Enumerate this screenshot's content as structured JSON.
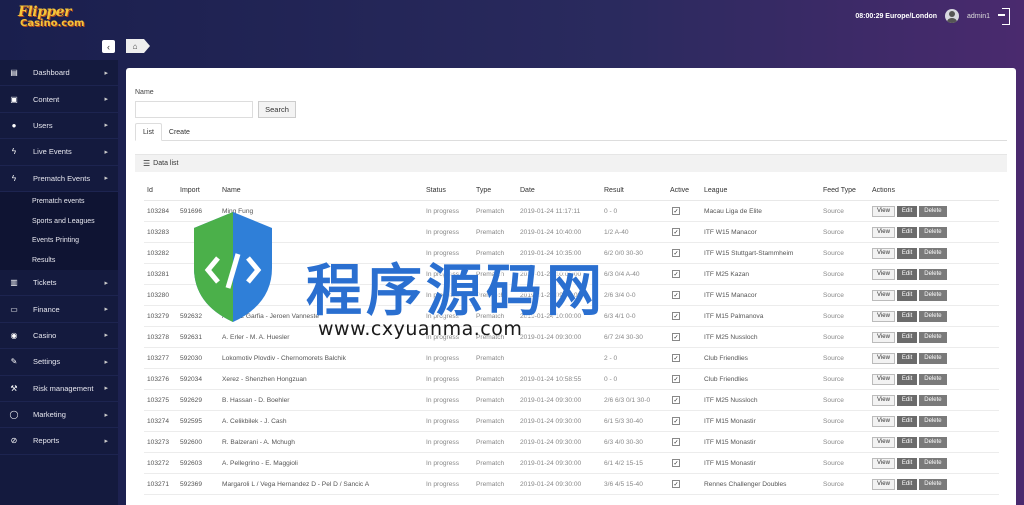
{
  "header": {
    "logo_line1": "Flipper",
    "logo_line2": "Casino.com",
    "clock": "08:00:29 Europe/London",
    "user": "admin1"
  },
  "sidebar": {
    "items": [
      {
        "label": "Dashboard",
        "icon": "dashboard-icon"
      },
      {
        "label": "Content",
        "icon": "book-icon"
      },
      {
        "label": "Users",
        "icon": "user-icon"
      },
      {
        "label": "Live Events",
        "icon": "bolt-icon"
      },
      {
        "label": "Prematch Events",
        "icon": "bolt-icon"
      }
    ],
    "sub_items": [
      "Prematch events",
      "Sports and Leagues",
      "Events Printing",
      "Results"
    ],
    "items2": [
      {
        "label": "Tickets",
        "icon": "ticket-icon"
      },
      {
        "label": "Finance",
        "icon": "money-icon"
      },
      {
        "label": "Casino",
        "icon": "chip-icon"
      },
      {
        "label": "Settings",
        "icon": "wrench-icon"
      },
      {
        "label": "Risk management",
        "icon": "gavel-icon"
      },
      {
        "label": "Marketing",
        "icon": "chat-icon"
      },
      {
        "label": "Reports",
        "icon": "paperclip-icon"
      }
    ]
  },
  "filter": {
    "label": "Name",
    "value": "",
    "search_label": "Search"
  },
  "tabs": [
    "List",
    "Create"
  ],
  "data_list": {
    "title": "Data list",
    "columns": [
      "Id",
      "Import",
      "Name",
      "Status",
      "Type",
      "Date",
      "Result",
      "Active",
      "League",
      "Feed Type",
      "Actions"
    ],
    "actions": [
      "View",
      "Edit",
      "Delete"
    ],
    "rows": [
      {
        "id": "103284",
        "import": "591696",
        "name": "Ming Fung",
        "status": "In progress",
        "type": "Prematch",
        "date": "2019-01-24 11:17:11",
        "result": "0 - 0",
        "league": "Macau Liga de Elite",
        "feed": "Source"
      },
      {
        "id": "103283",
        "import": "",
        "name": "",
        "status": "In progress",
        "type": "Prematch",
        "date": "2019-01-24 10:40:00",
        "result": "1/2 A-40",
        "league": "ITF W15 Manacor",
        "feed": "Source"
      },
      {
        "id": "103282",
        "import": "",
        "name": "",
        "status": "In progress",
        "type": "Prematch",
        "date": "2019-01-24 10:35:00",
        "result": "6/2 0/0 30-30",
        "league": "ITF W15 Stuttgart-Stammheim",
        "feed": "Source"
      },
      {
        "id": "103281",
        "import": "",
        "name": "",
        "status": "In progress",
        "type": "Prematch",
        "date": "2019-01-24 10:05:00",
        "result": "6/3 0/4 A-40",
        "league": "ITF M25 Kazan",
        "feed": "Source"
      },
      {
        "id": "103280",
        "import": "",
        "name": "Ureke",
        "status": "In progress",
        "type": "Prematch",
        "date": "2019-01-24 09:55:00",
        "result": "2/6 3/4 0-0",
        "league": "ITF W15 Manacor",
        "feed": "Source"
      },
      {
        "id": "103279",
        "import": "592632",
        "name": "Alcaraz Garfia - Jeroen Vanneste",
        "status": "In progress",
        "type": "Prematch",
        "date": "2019-01-24 10:00:00",
        "result": "6/3 4/1 0-0",
        "league": "ITF M15 Palmanova",
        "feed": "Source"
      },
      {
        "id": "103278",
        "import": "592631",
        "name": "A. Erler - M. A. Huesler",
        "status": "In progress",
        "type": "Prematch",
        "date": "2019-01-24 09:30:00",
        "result": "6/7 2/4 30-30",
        "league": "ITF M25 Nussloch",
        "feed": "Source"
      },
      {
        "id": "103277",
        "import": "592030",
        "name": "Lokomotiv Plovdiv - Chernomorets Balchik",
        "status": "In progress",
        "type": "Prematch",
        "date": "",
        "result": "2 - 0",
        "league": "Club Friendlies",
        "feed": "Source"
      },
      {
        "id": "103276",
        "import": "592034",
        "name": "Xerez - Shenzhen Hongzuan",
        "status": "In progress",
        "type": "Prematch",
        "date": "2019-01-24 10:58:55",
        "result": "0 - 0",
        "league": "Club Friendlies",
        "feed": "Source"
      },
      {
        "id": "103275",
        "import": "592629",
        "name": "B. Hassan - D. Boehler",
        "status": "In progress",
        "type": "Prematch",
        "date": "2019-01-24 09:30:00",
        "result": "2/6 6/3 0/1 30-0",
        "league": "ITF M25 Nussloch",
        "feed": "Source"
      },
      {
        "id": "103274",
        "import": "592595",
        "name": "A. Celikbilek - J. Cash",
        "status": "In progress",
        "type": "Prematch",
        "date": "2019-01-24 09:30:00",
        "result": "6/1 5/3 30-40",
        "league": "ITF M15 Monastir",
        "feed": "Source"
      },
      {
        "id": "103273",
        "import": "592600",
        "name": "R. Balzerani - A. Mchugh",
        "status": "In progress",
        "type": "Prematch",
        "date": "2019-01-24 09:30:00",
        "result": "6/3 4/0 30-30",
        "league": "ITF M15 Monastir",
        "feed": "Source"
      },
      {
        "id": "103272",
        "import": "592603",
        "name": "A. Pellegrino - E. Maggioli",
        "status": "In progress",
        "type": "Prematch",
        "date": "2019-01-24 09:30:00",
        "result": "6/1 4/2 15-15",
        "league": "ITF M15 Monastir",
        "feed": "Source"
      },
      {
        "id": "103271",
        "import": "592369",
        "name": "Margaroli L / Vega Hernandez D - Pel D / Sancic A",
        "status": "In progress",
        "type": "Prematch",
        "date": "2019-01-24 09:30:00",
        "result": "3/6 4/5 15-40",
        "league": "Rennes Challenger Doubles",
        "feed": "Source"
      }
    ]
  },
  "watermark": {
    "text": "程序源码网",
    "url": "www.cxyuanma.com"
  }
}
